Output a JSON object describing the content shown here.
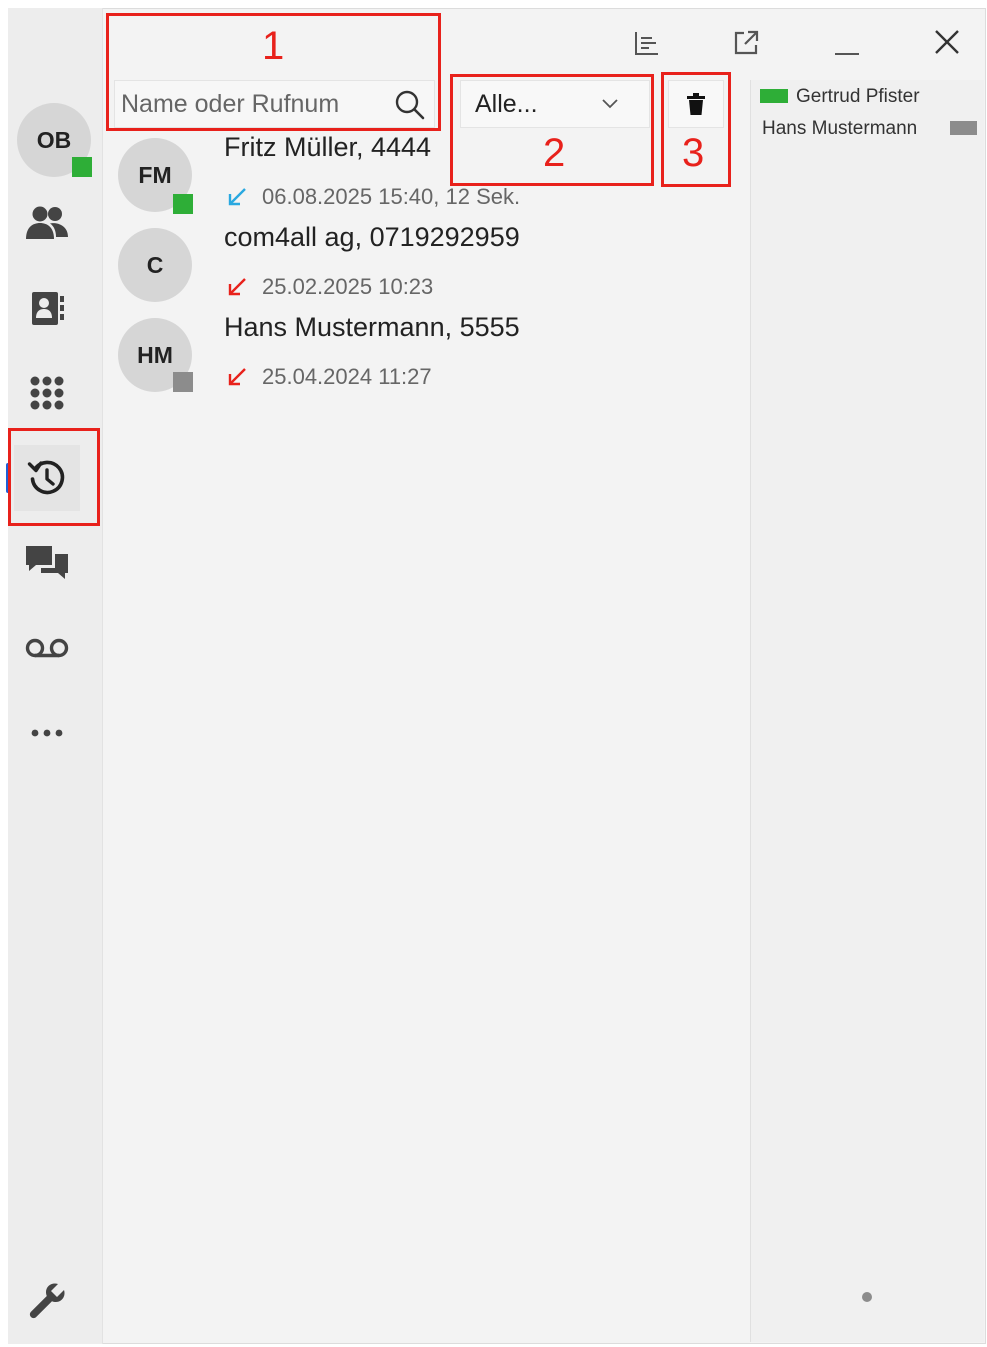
{
  "search": {
    "placeholder": "Name oder Rufnum"
  },
  "filter": {
    "selected": "Alle..."
  },
  "annotations": [
    "1",
    "2",
    "3"
  ],
  "user": {
    "initials": "OB",
    "status": "online"
  },
  "nav": [
    {
      "id": "contacts",
      "icon": "contacts-icon"
    },
    {
      "id": "phonebook",
      "icon": "address-book-icon"
    },
    {
      "id": "dialpad",
      "icon": "dialpad-icon"
    },
    {
      "id": "history",
      "icon": "history-icon",
      "active": true
    },
    {
      "id": "chat",
      "icon": "chat-icon"
    },
    {
      "id": "voicemail",
      "icon": "voicemail-icon"
    },
    {
      "id": "more",
      "icon": "more-icon"
    },
    {
      "id": "settings",
      "icon": "wrench-icon"
    }
  ],
  "calls": [
    {
      "initials": "FM",
      "name": "Fritz Müller, 4444",
      "meta": "06.08.2025 15:40, 12 Sek.",
      "direction": "incoming-answered",
      "presence": "online"
    },
    {
      "initials": "C",
      "name": "com4all ag, 0719292959",
      "meta": "25.02.2025 10:23",
      "direction": "incoming-missed",
      "presence": "none"
    },
    {
      "initials": "HM",
      "name": "Hans Mustermann, 5555",
      "meta": "25.04.2024 11:27",
      "direction": "incoming-missed",
      "presence": "offline"
    }
  ],
  "right_panel": [
    {
      "name": "Gertrud Pfister",
      "presence": "online"
    },
    {
      "name": "Hans Mustermann",
      "presence": "offline"
    }
  ],
  "colors": {
    "annotation": "#e8211b",
    "online": "#2eae37",
    "offline": "#8c8c8c",
    "active_nav": "#1f5fd6",
    "call_answered": "#29a8e0",
    "call_missed": "#e8211b"
  }
}
